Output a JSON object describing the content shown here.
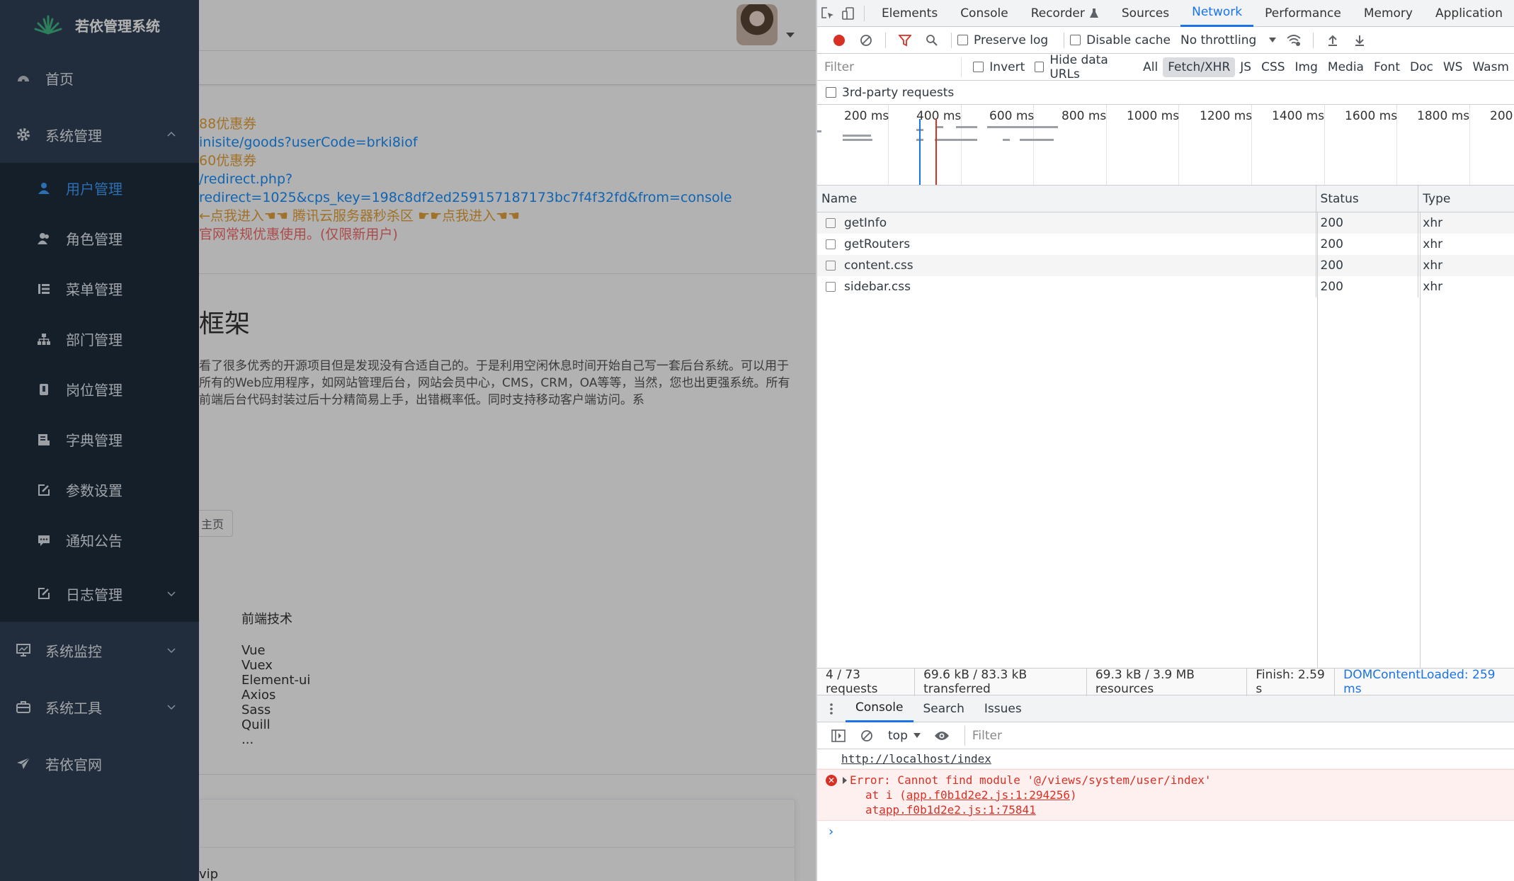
{
  "app": {
    "title": "若依管理系统",
    "sidebar": {
      "items": [
        {
          "label": "首页",
          "icon": "dashboard-icon"
        },
        {
          "label": "系统管理",
          "icon": "gear-icon",
          "expanded": true,
          "children": [
            {
              "label": "用户管理",
              "icon": "user-icon",
              "active": true
            },
            {
              "label": "角色管理",
              "icon": "peoples-icon"
            },
            {
              "label": "菜单管理",
              "icon": "tree-table-icon"
            },
            {
              "label": "部门管理",
              "icon": "tree-icon"
            },
            {
              "label": "岗位管理",
              "icon": "post-icon"
            },
            {
              "label": "字典管理",
              "icon": "dict-icon"
            },
            {
              "label": "参数设置",
              "icon": "edit-icon"
            },
            {
              "label": "通知公告",
              "icon": "message-icon"
            },
            {
              "label": "日志管理",
              "icon": "log-icon"
            }
          ]
        },
        {
          "label": "系统监控",
          "icon": "monitor-icon"
        },
        {
          "label": "系统工具",
          "icon": "tool-icon"
        },
        {
          "label": "若依官网",
          "icon": "guide-icon"
        }
      ]
    },
    "main": {
      "promo": [
        {
          "text": "88优惠券",
          "color": "orange"
        },
        {
          "text": "inisite/goods?userCode=brki8iof",
          "color": "blue"
        },
        {
          "text": "60优惠券",
          "color": "orange"
        },
        {
          "text": "/redirect.php?redirect=1025&cps_key=198c8df2ed259157187173bc7f4f32fd&from=console",
          "color": "blue"
        },
        {
          "text": "←点我进入☚☚ 腾讯云服务器秒杀区 ☛☛点我进入☚☚",
          "color": "mixed"
        },
        {
          "text": "官网常规优惠使用。(仅限新用户)",
          "color": "red"
        }
      ],
      "title": "框架",
      "desc": "看了很多优秀的开源项目但是发现没有合适自己的。于是利用空闲休息时间开始自己写一套后台系统。可以用于所有的Web应用程序，如网站管理后台，网站会员中心，CMS，CRM，OA等等，当然，您也出更强系统。所有前端后台代码封装过后十分精简易上手，出错概率低。同时支持移动客户端访问。系",
      "home_button": "主页",
      "tech_title": "前端技术",
      "tech": [
        "Vue",
        "Vuex",
        "Element-ui",
        "Axios",
        "Sass",
        "Quill",
        "..."
      ],
      "card_text": "vip"
    }
  },
  "devtools": {
    "tabs": [
      "Elements",
      "Console",
      "Recorder",
      "Sources",
      "Network",
      "Performance",
      "Memory",
      "Application"
    ],
    "active_tab": "Network",
    "toolbar": {
      "preserve_log": "Preserve log",
      "disable_cache": "Disable cache",
      "throttling": "No throttling"
    },
    "filter": {
      "placeholder": "Filter",
      "invert": "Invert",
      "hide_data_urls": "Hide data URLs",
      "types": [
        "All",
        "Fetch/XHR",
        "JS",
        "CSS",
        "Img",
        "Media",
        "Font",
        "Doc",
        "WS",
        "Wasm"
      ],
      "active_type": "Fetch/XHR",
      "third_party": "3rd-party requests"
    },
    "timeline": {
      "labels": [
        "200 ms",
        "400 ms",
        "600 ms",
        "800 ms",
        "1000 ms",
        "1200 ms",
        "1400 ms",
        "1600 ms",
        "1800 ms",
        "200"
      ]
    },
    "table": {
      "headers": {
        "name": "Name",
        "status": "Status",
        "type": "Type"
      },
      "rows": [
        {
          "name": "getInfo",
          "status": "200",
          "type": "xhr"
        },
        {
          "name": "getRouters",
          "status": "200",
          "type": "xhr"
        },
        {
          "name": "content.css",
          "status": "200",
          "type": "xhr"
        },
        {
          "name": "sidebar.css",
          "status": "200",
          "type": "xhr"
        }
      ]
    },
    "summary": {
      "requests": "4 / 73 requests",
      "transferred": "69.6 kB / 83.3 kB transferred",
      "resources": "69.3 kB / 3.9 MB resources",
      "finish": "Finish: 2.59 s",
      "dcl": "DOMContentLoaded: 259 ms"
    },
    "drawer": {
      "tabs": [
        "Console",
        "Search",
        "Issues"
      ],
      "active": "Console",
      "context": "top",
      "filter_placeholder": "Filter"
    },
    "console": {
      "url": "http://localhost/index",
      "error": "Error: Cannot find module '@/views/system/user/index'",
      "stack1_prefix": "at i (",
      "stack1_link": "app.f0b1d2e2.js:1:294256",
      "stack1_suffix": ")",
      "stack2_prefix": "at ",
      "stack2_link": "app.f0b1d2e2.js:1:75841"
    }
  }
}
